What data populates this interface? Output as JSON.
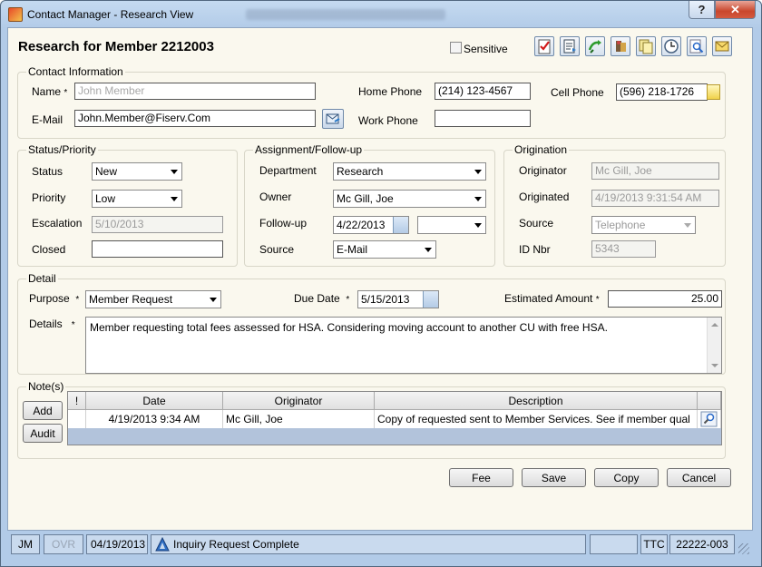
{
  "window": {
    "title": "Contact Manager - Research View",
    "help_label": "?",
    "close_label": "✕"
  },
  "header": {
    "title": "Research for Member 2212003",
    "sensitive_label": "Sensitive",
    "toolbar_icons": [
      "checklist-icon",
      "document-icon",
      "transfer-icon",
      "people-icon",
      "copy-icon",
      "clock-icon",
      "search-icon",
      "envelope-icon"
    ]
  },
  "contact": {
    "group_label": "Contact Information",
    "name_label": "Name",
    "name_placeholder": "John Member",
    "home_phone_label": "Home Phone",
    "home_phone": "(214) 123-4567",
    "cell_phone_label": "Cell Phone",
    "cell_phone": "(596) 218-1726",
    "email_label": "E-Mail",
    "email": "John.Member@Fiserv.Com",
    "work_phone_label": "Work Phone",
    "work_phone": ""
  },
  "status": {
    "group_label": "Status/Priority",
    "status_label": "Status",
    "status_value": "New",
    "priority_label": "Priority",
    "priority_value": "Low",
    "escalation_label": "Escalation",
    "escalation_value": "5/10/2013",
    "closed_label": "Closed",
    "closed_value": ""
  },
  "assignment": {
    "group_label": "Assignment/Follow-up",
    "department_label": "Department",
    "department_value": "Research",
    "owner_label": "Owner",
    "owner_value": "Mc Gill, Joe",
    "followup_label": "Follow-up",
    "followup_date": "4/22/2013",
    "followup_time": "",
    "source_label": "Source",
    "source_value": "E-Mail"
  },
  "origination": {
    "group_label": "Origination",
    "originator_label": "Originator",
    "originator_value": "Mc Gill, Joe",
    "originated_label": "Originated",
    "originated_value": "4/19/2013 9:31:54 AM",
    "source_label": "Source",
    "source_value": "Telephone",
    "id_label": "ID Nbr",
    "id_value": "5343"
  },
  "detail": {
    "group_label": "Detail",
    "purpose_label": "Purpose",
    "purpose_value": "Member Request",
    "due_date_label": "Due Date",
    "due_date_value": "5/15/2013",
    "estimated_label": "Estimated Amount",
    "estimated_value": "25.00",
    "details_label": "Details",
    "details_text": "Member requesting total fees assessed for HSA. Considering moving account to another CU with free HSA."
  },
  "notes": {
    "group_label": "Note(s)",
    "add_label": "Add",
    "audit_label": "Audit",
    "columns": [
      "!",
      "Date",
      "Originator",
      "Description"
    ],
    "rows": [
      {
        "flag": "",
        "date": "4/19/2013 9:34 AM",
        "originator": "Mc Gill, Joe",
        "description": "Copy of requested sent to Member Services. See if member qual"
      }
    ]
  },
  "actions": {
    "fee_label": "Fee",
    "save_label": "Save",
    "copy_label": "Copy",
    "cancel_label": "Cancel"
  },
  "statusbar": {
    "user": "JM",
    "ovr": "OVR",
    "date": "04/19/2013",
    "message": "Inquiry Request Complete",
    "ttc": "TTC",
    "code": "22222-003"
  }
}
